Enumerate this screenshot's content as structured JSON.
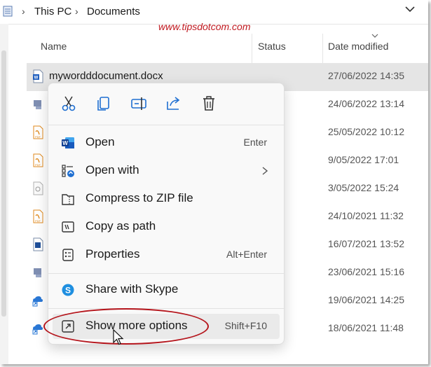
{
  "addressbar": {
    "crumbs": [
      "This PC",
      "Documents"
    ]
  },
  "watermark": "www.tipsdotcom.com",
  "columns": {
    "name": "Name",
    "status": "Status",
    "date_modified": "Date modified"
  },
  "files": [
    {
      "name": "mywordddocument.docx",
      "date": "27/06/2022 14:35",
      "icon": "word-doc-icon",
      "selected": true
    },
    {
      "name": "",
      "date": "24/06/2022 13:14",
      "icon": "shortcut-icon"
    },
    {
      "name": "",
      "date": "25/05/2022 10:12",
      "icon": "pdf-icon"
    },
    {
      "name": "",
      "date": "9/05/2022 17:01",
      "icon": "pdf-icon"
    },
    {
      "name": "",
      "date": "3/05/2022 15:24",
      "icon": "file-icon"
    },
    {
      "name": "",
      "date": "24/10/2021 11:32",
      "icon": "pdf-icon"
    },
    {
      "name": "",
      "date": "16/07/2021 13:52",
      "icon": "image-icon"
    },
    {
      "name": "",
      "date": "23/06/2021 15:16",
      "icon": "shortcut-icon"
    },
    {
      "name": "",
      "date": "19/06/2021 14:25",
      "icon": "cloud-shortcut-icon"
    },
    {
      "name": "",
      "date": "18/06/2021 11:48",
      "icon": "cloud-shortcut-icon"
    }
  ],
  "context_menu": {
    "toolbar": [
      "cut-icon",
      "copy-icon",
      "rename-icon",
      "share-icon",
      "delete-icon"
    ],
    "items": [
      {
        "label": "Open",
        "shortcut": "Enter",
        "icon": "word-icon"
      },
      {
        "label": "Open with",
        "shortcut": "",
        "icon": "open-with-icon",
        "submenu": true
      },
      {
        "label": "Compress to ZIP file",
        "shortcut": "",
        "icon": "zip-icon"
      },
      {
        "label": "Copy as path",
        "shortcut": "",
        "icon": "copy-path-icon"
      },
      {
        "label": "Properties",
        "shortcut": "Alt+Enter",
        "icon": "properties-icon"
      },
      {
        "label": "Share with Skype",
        "shortcut": "",
        "icon": "skype-icon"
      },
      {
        "label": "Show more options",
        "shortcut": "Shift+F10",
        "icon": "show-more-icon",
        "highlighted": true
      }
    ]
  },
  "colors": {
    "accent_blue": "#1f6fd1",
    "highlight_oval": "#b5151c",
    "watermark": "#c0181f",
    "selected_row": "#e5e5e5",
    "menu_bg": "#f9f9f9"
  }
}
